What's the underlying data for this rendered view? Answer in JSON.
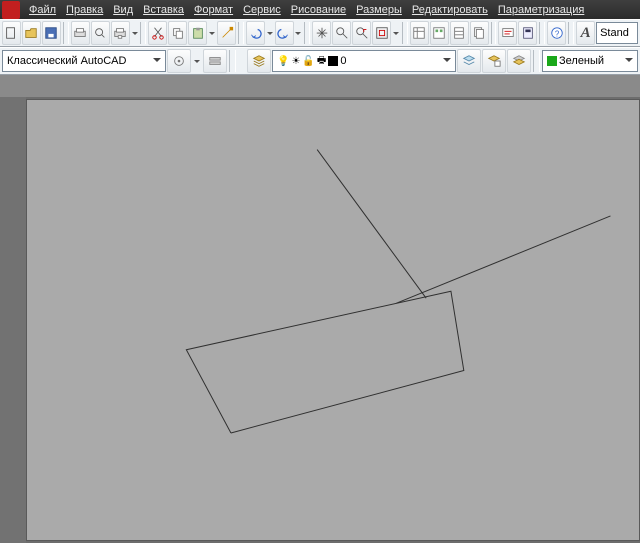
{
  "menu": {
    "items": [
      "Файл",
      "Правка",
      "Вид",
      "Вставка",
      "Формат",
      "Сервис",
      "Рисование",
      "Размеры",
      "Редактировать",
      "Параметризация"
    ]
  },
  "toolbar1": {
    "style_label": "Stand"
  },
  "toolbar2": {
    "workspace": "Классический AutoCAD",
    "layer_value": "0",
    "color_value": "Зеленый"
  },
  "icons": {
    "new": "new-icon",
    "open": "open-icon",
    "save": "save-icon",
    "plot": "plot-icon",
    "preview": "preview-icon",
    "publish": "publish-icon",
    "cut": "cut-icon",
    "copy": "copy-icon",
    "paste": "paste-icon",
    "match": "match-icon",
    "undo": "undo-icon",
    "redo": "redo-icon",
    "pan": "pan-icon",
    "zoom": "zoom-icon",
    "zoomprev": "zoomprev-icon",
    "zoomext": "zoomext-icon",
    "props": "props-icon",
    "dcenter": "dcenter-icon",
    "toolpal": "toolpal-icon",
    "sheet": "sheet-icon",
    "markup": "markup-icon",
    "calc": "calc-icon",
    "help": "help-icon",
    "ws": "workspace-icon",
    "wsgear": "ws-settings-icon",
    "wslock": "ws-toolbar-icon",
    "layermgr": "layer-mgr-icon",
    "layfilter": "layer-filter-icon",
    "laystate": "layer-state-icon",
    "layiso": "layer-iso-icon"
  }
}
